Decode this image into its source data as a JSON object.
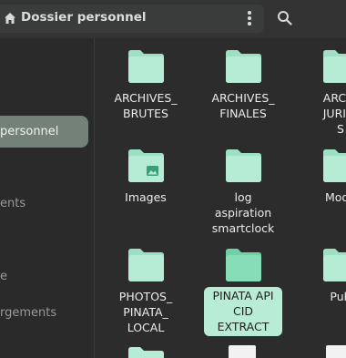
{
  "header": {
    "path_label": "Dossier personnel",
    "home_icon": "home-icon",
    "menu_icon": "kebab-menu-icon",
    "search_icon": "search-icon"
  },
  "sidebar": {
    "items": [
      {
        "label": "personnel",
        "active": true
      },
      {
        "label": "ents",
        "active": false
      },
      {
        "label": "e",
        "active": false
      },
      {
        "label": "rgements",
        "active": false
      }
    ]
  },
  "files": [
    {
      "name": "ARCHIVES_\nBRUTES",
      "type": "folder"
    },
    {
      "name": "ARCHIVES_\nFINALES",
      "type": "folder"
    },
    {
      "name": "ARCHI\nJURIDI\nS",
      "type": "folder"
    },
    {
      "name": "Images",
      "type": "folder-images"
    },
    {
      "name": "log\naspiration\nsmartclock",
      "type": "folder"
    },
    {
      "name": "Modè",
      "type": "folder-templates"
    },
    {
      "name": "PHOTOS_\nPINATA_\nLOCAL",
      "type": "folder"
    },
    {
      "name": "PINATA API\nCID\nEXTRACT",
      "type": "folder",
      "selected": true
    },
    {
      "name": "Pub",
      "type": "folder-public"
    }
  ],
  "colors": {
    "folder": "#b6ecd6",
    "folder_tab": "#9ee0c3",
    "folder_selected": "#86ddb8",
    "selection_bg": "#b8ecd4",
    "sidebar_active": "#738177"
  }
}
